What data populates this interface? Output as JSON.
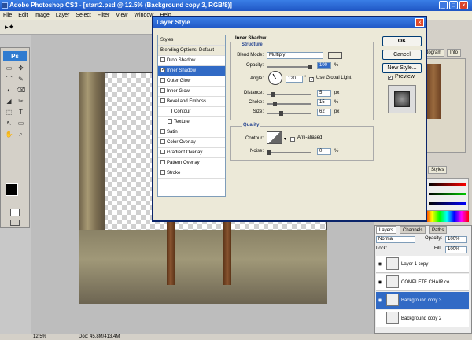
{
  "app": {
    "title": "Adobe Photoshop CS3 - [start2.psd @ 12.5% (Background copy 3, RGB/8)]"
  },
  "menu": [
    "File",
    "Edit",
    "Image",
    "Layer",
    "Select",
    "Filter",
    "View",
    "Window",
    "Help"
  ],
  "options": {
    "workspace_label": "space"
  },
  "toolbox": {
    "badge": "Ps",
    "tools": [
      "▭",
      "✥",
      "⌒",
      "✎",
      "◐",
      "⌫",
      "◢",
      "✂",
      "⬚",
      "T",
      "↖",
      "▭",
      "✋",
      "⌕"
    ]
  },
  "status": {
    "zoom": "12.5%",
    "doc": "Doc: 45.8M/413.4M"
  },
  "right_panel": {
    "tabs_top": [
      "Histogram",
      "Info"
    ],
    "styles_tab": "Styles",
    "layers_tabs": [
      "Layers",
      "Channels",
      "Paths"
    ],
    "blend": "Normal",
    "opacity_label": "Opacity:",
    "opacity_value": "100%",
    "lock_label": "Lock:",
    "fill_label": "Fill:",
    "fill_value": "100%"
  },
  "layers": [
    {
      "name": "Layer 1 copy",
      "selected": false
    },
    {
      "name": "COMPLETE CHAIR co...",
      "selected": false
    },
    {
      "name": "Background copy 3",
      "selected": true
    },
    {
      "name": "Background copy 2",
      "selected": false
    }
  ],
  "dialog": {
    "title": "Layer Style",
    "styles_header": "Styles",
    "blending": "Blending Options: Default",
    "items": [
      {
        "label": "Drop Shadow",
        "checked": false,
        "active": false,
        "sub": false
      },
      {
        "label": "Inner Shadow",
        "checked": true,
        "active": true,
        "sub": false
      },
      {
        "label": "Outer Glow",
        "checked": false,
        "active": false,
        "sub": false
      },
      {
        "label": "Inner Glow",
        "checked": false,
        "active": false,
        "sub": false
      },
      {
        "label": "Bevel and Emboss",
        "checked": false,
        "active": false,
        "sub": false
      },
      {
        "label": "Contour",
        "checked": false,
        "active": false,
        "sub": true
      },
      {
        "label": "Texture",
        "checked": false,
        "active": false,
        "sub": true
      },
      {
        "label": "Satin",
        "checked": false,
        "active": false,
        "sub": false
      },
      {
        "label": "Color Overlay",
        "checked": false,
        "active": false,
        "sub": false
      },
      {
        "label": "Gradient Overlay",
        "checked": false,
        "active": false,
        "sub": false
      },
      {
        "label": "Pattern Overlay",
        "checked": false,
        "active": false,
        "sub": false
      },
      {
        "label": "Stroke",
        "checked": false,
        "active": false,
        "sub": false
      }
    ],
    "section_title": "Inner Shadow",
    "structure": "Structure",
    "blend_mode_label": "Blend Mode:",
    "blend_mode": "Multiply",
    "opacity_label": "Opacity:",
    "opacity": "100",
    "angle_label": "Angle:",
    "angle": "120",
    "global_light": "Use Global Light",
    "distance_label": "Distance:",
    "distance": "5",
    "choke_label": "Choke:",
    "choke": "15",
    "size_label": "Size:",
    "size": "62",
    "px": "px",
    "pct": "%",
    "deg": "°",
    "quality": "Quality",
    "contour_label": "Contour:",
    "anti_aliased": "Anti-aliased",
    "noise_label": "Noise:",
    "noise": "0",
    "buttons": {
      "ok": "OK",
      "cancel": "Cancel",
      "new_style": "New Style...",
      "preview": "Preview"
    },
    "shadow_color": "#000000"
  }
}
